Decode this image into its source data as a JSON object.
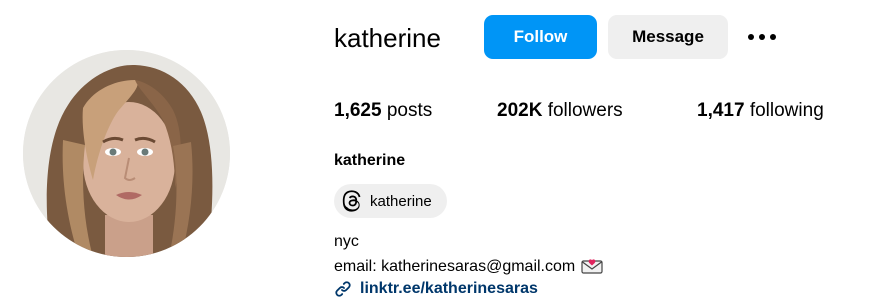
{
  "profile": {
    "username": "katherine",
    "full_name": "katherine",
    "avatar_icon": "profile-photo",
    "follow_label": "Follow",
    "message_label": "Message",
    "more_icon": "more-options-icon"
  },
  "stats": {
    "posts_count": "1,625",
    "posts_label": "posts",
    "followers_count": "202K",
    "followers_label": "followers",
    "following_count": "1,417",
    "following_label": "following"
  },
  "threads": {
    "icon": "threads-icon",
    "handle": "katherine"
  },
  "bio": {
    "location": "nyc",
    "email_line": "email: katherinesaras@gmail.com",
    "email_emoji_icon": "envelope-heart-icon",
    "link_icon": "link-icon",
    "link_text": "linktr.ee/katherinesaras"
  },
  "colors": {
    "follow_button": "#0095f6",
    "secondary_button": "#efefef",
    "link": "#00376b"
  }
}
